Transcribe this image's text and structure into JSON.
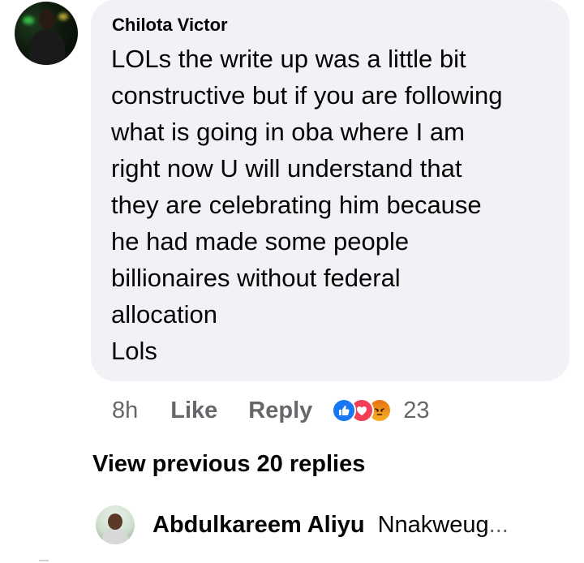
{
  "comment": {
    "author": "Chilota Victor",
    "text": "LOLs the write up was a little bit\nconstructive but if you are following\nwhat is going in oba where I am\nright now U will understand that\nthey are celebrating him because\nhe had made some people\nbillionaires without federal\nallocation\nLols",
    "time": "8h",
    "like_label": "Like",
    "reply_label": "Reply",
    "reaction_count": "23",
    "reactions": [
      "like-icon",
      "love-icon",
      "angry-icon"
    ]
  },
  "replies": {
    "view_previous_label": "View previous 20 replies",
    "latest": {
      "author": "Abdulkareem Aliyu",
      "snippet": "Nnakweug",
      "ellipsis": "..."
    }
  },
  "colors": {
    "bubble": "#f0f2f5",
    "text": "#050505",
    "secondary": "#65676b",
    "like": "#1877f2",
    "love": "#f33e58",
    "angry": "#e9710f"
  }
}
